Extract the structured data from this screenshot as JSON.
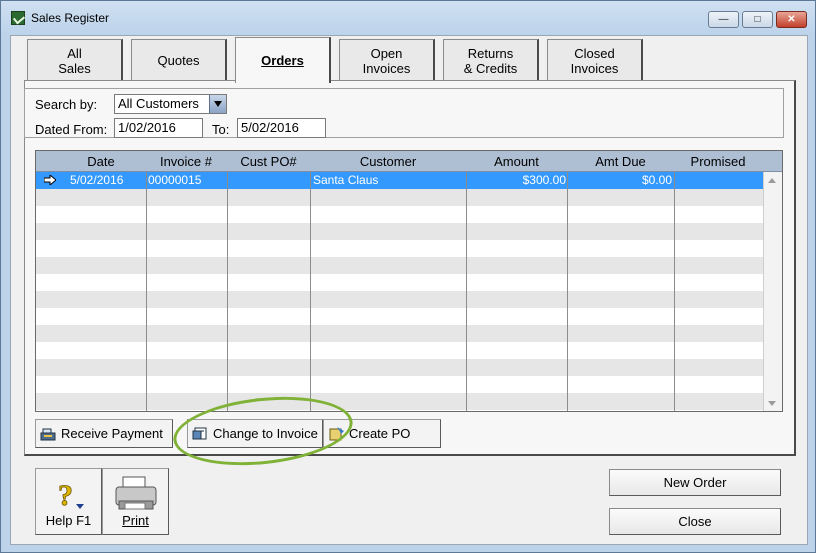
{
  "window": {
    "title": "Sales Register",
    "controls": {
      "minimize": "—",
      "maximize": "□",
      "close": "✕"
    }
  },
  "tabs": [
    {
      "label": "All\nSales",
      "active": false
    },
    {
      "label": "Quotes",
      "active": false
    },
    {
      "label": "Orders",
      "active": true
    },
    {
      "label": "Open\nInvoices",
      "active": false
    },
    {
      "label": "Returns\n& Credits",
      "active": false
    },
    {
      "label": "Closed\nInvoices",
      "active": false
    }
  ],
  "filters": {
    "search_by_label": "Search by:",
    "search_by_value": "All Customers",
    "dated_from_label": "Dated From:",
    "dated_from_value": "1/02/2016",
    "to_label": "To:",
    "to_value": "5/02/2016"
  },
  "table": {
    "columns": [
      "Date",
      "Invoice #",
      "Cust PO#",
      "Customer",
      "Amount",
      "Amt Due",
      "Promised"
    ],
    "rows": [
      {
        "date": "5/02/2016",
        "invoice": "00000015",
        "cust_po": "",
        "customer": "Santa Claus",
        "amount": "$300.00",
        "amt_due": "$0.00",
        "promised": "",
        "selected": true
      }
    ]
  },
  "actions": {
    "receive_payment": "Receive Payment",
    "change_to_invoice": "Change to Invoice",
    "create_po": "Create PO"
  },
  "footer": {
    "help": "Help F1",
    "print": "Print",
    "new_order": "New Order",
    "close": "Close"
  },
  "colors": {
    "selection": "#3399ff",
    "header": "#aebfd4",
    "highlight_ring": "#7fb236"
  }
}
